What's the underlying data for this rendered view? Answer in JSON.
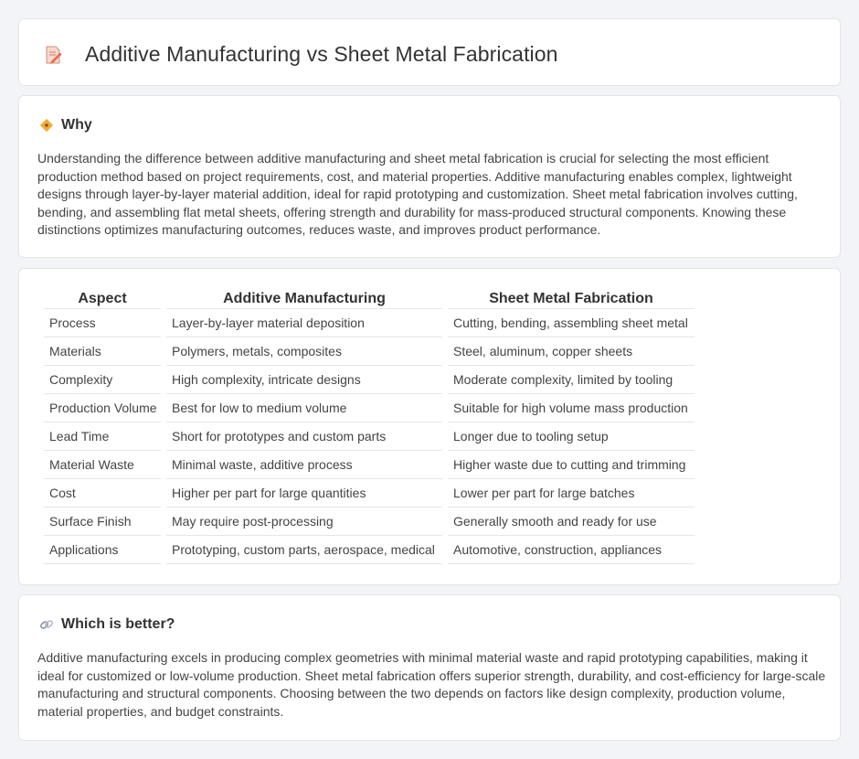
{
  "header": {
    "title": "Additive Manufacturing vs Sheet Metal Fabrication",
    "icon": "document-edit-icon"
  },
  "why": {
    "icon": "diamond-warning-icon",
    "heading": "Why",
    "text": "Understanding the difference between additive manufacturing and sheet metal fabrication is crucial for selecting the most efficient production method based on project requirements, cost, and material properties. Additive manufacturing enables complex, lightweight designs through layer-by-layer material addition, ideal for rapid prototyping and customization. Sheet metal fabrication involves cutting, bending, and assembling flat metal sheets, offering strength and durability for mass-produced structural components. Knowing these distinctions optimizes manufacturing outcomes, reduces waste, and improves product performance."
  },
  "comparison": {
    "headers": [
      "Aspect",
      "Additive Manufacturing",
      "Sheet Metal Fabrication"
    ],
    "rows": [
      [
        "Process",
        "Layer-by-layer material deposition",
        "Cutting, bending, assembling sheet metal"
      ],
      [
        "Materials",
        "Polymers, metals, composites",
        "Steel, aluminum, copper sheets"
      ],
      [
        "Complexity",
        "High complexity, intricate designs",
        "Moderate complexity, limited by tooling"
      ],
      [
        "Production Volume",
        "Best for low to medium volume",
        "Suitable for high volume mass production"
      ],
      [
        "Lead Time",
        "Short for prototypes and custom parts",
        "Longer due to tooling setup"
      ],
      [
        "Material Waste",
        "Minimal waste, additive process",
        "Higher waste due to cutting and trimming"
      ],
      [
        "Cost",
        "Higher per part for large quantities",
        "Lower per part for large batches"
      ],
      [
        "Surface Finish",
        "May require post-processing",
        "Generally smooth and ready for use"
      ],
      [
        "Applications",
        "Prototyping, custom parts, aerospace, medical",
        "Automotive, construction, appliances"
      ]
    ]
  },
  "better": {
    "icon": "link-icon",
    "heading": "Which is better?",
    "text": "Additive manufacturing excels in producing complex geometries with minimal material waste and rapid prototyping capabilities, making it ideal for customized or low-volume production. Sheet metal fabrication offers superior strength, durability, and cost-efficiency for large-scale manufacturing and structural components. Choosing between the two depends on factors like design complexity, production volume, material properties, and budget constraints."
  }
}
